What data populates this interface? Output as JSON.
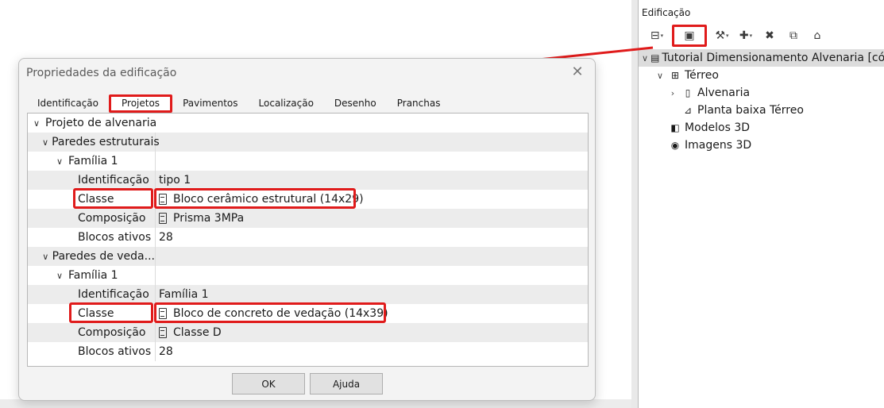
{
  "panel": {
    "title": "Edificação",
    "toolbar": [
      {
        "icon": "folder-icon",
        "glyph": "⊟",
        "caret": "▾"
      },
      {
        "icon": "building-properties-icon",
        "glyph": "▣",
        "caret": ""
      },
      {
        "icon": "tools-icon",
        "glyph": "⚒",
        "caret": "▾"
      },
      {
        "icon": "add-icon",
        "glyph": "✚",
        "caret": "▾"
      },
      {
        "icon": "delete-icon",
        "glyph": "✖",
        "caret": ""
      },
      {
        "icon": "new-sheet-icon",
        "glyph": "⧉",
        "caret": ""
      },
      {
        "icon": "building-icon",
        "glyph": "⌂",
        "caret": ""
      }
    ],
    "tree": [
      {
        "label": "Tutorial Dimensionamento Alvenaria [cóp",
        "toggle": "∨",
        "icon": "▤",
        "indent": 0,
        "selected": true
      },
      {
        "label": "Térreo",
        "toggle": "∨",
        "icon": "⊞",
        "indent": 1,
        "selected": false
      },
      {
        "label": "Alvenaria",
        "toggle": "›",
        "icon": "▯",
        "indent": 2,
        "selected": false
      },
      {
        "label": "Planta baixa Térreo",
        "toggle": "",
        "icon": "⊿",
        "indent": 2,
        "selected": false
      },
      {
        "label": "Modelos 3D",
        "toggle": "",
        "icon": "◧",
        "indent": 1,
        "selected": false
      },
      {
        "label": "Imagens 3D",
        "toggle": "",
        "icon": "◉",
        "indent": 1,
        "selected": false
      }
    ]
  },
  "dialog": {
    "title": "Propriedades da edificação",
    "close_glyph": "✕",
    "tabs": [
      "Identificação",
      "Projetos",
      "Pavimentos",
      "Localização",
      "Desenho",
      "Pranchas"
    ],
    "active_tab": "Projetos",
    "rows": [
      {
        "label": "Projeto de alvenaria",
        "value": "",
        "level": 0,
        "toggle": "∨",
        "icon": false,
        "span": true
      },
      {
        "label": "Paredes estruturais",
        "value": "",
        "level": 1,
        "toggle": "∨",
        "icon": false,
        "span": false
      },
      {
        "label": "Família 1",
        "value": "",
        "level": 2,
        "toggle": "∨",
        "icon": false,
        "span": false
      },
      {
        "label": "Identificação",
        "value": "tipo 1",
        "level": 3,
        "toggle": "",
        "icon": false,
        "span": false
      },
      {
        "label": "Classe",
        "value": "Bloco cerâmico estrutural (14x29)",
        "level": 3,
        "toggle": "",
        "icon": true,
        "span": false
      },
      {
        "label": "Composição",
        "value": "Prisma 3MPa",
        "level": 3,
        "toggle": "",
        "icon": true,
        "span": false
      },
      {
        "label": "Blocos ativos",
        "value": "28",
        "level": 3,
        "toggle": "",
        "icon": false,
        "span": false
      },
      {
        "label": "Paredes de veda...",
        "value": "",
        "level": 1,
        "toggle": "∨",
        "icon": false,
        "span": false
      },
      {
        "label": "Família 1",
        "value": "",
        "level": 2,
        "toggle": "∨",
        "icon": false,
        "span": false
      },
      {
        "label": "Identificação",
        "value": "Família 1",
        "level": 3,
        "toggle": "",
        "icon": false,
        "span": false
      },
      {
        "label": "Classe",
        "value": "Bloco de concreto de vedação (14x39)",
        "level": 3,
        "toggle": "",
        "icon": true,
        "span": false
      },
      {
        "label": "Composição",
        "value": "Classe D",
        "level": 3,
        "toggle": "",
        "icon": true,
        "span": false
      },
      {
        "label": "Blocos ativos",
        "value": "28",
        "level": 3,
        "toggle": "",
        "icon": false,
        "span": false
      }
    ],
    "ok_label": "OK",
    "help_label": "Ajuda"
  },
  "colors": {
    "highlight": "#e01b1b",
    "row_grey": "#ececec"
  }
}
